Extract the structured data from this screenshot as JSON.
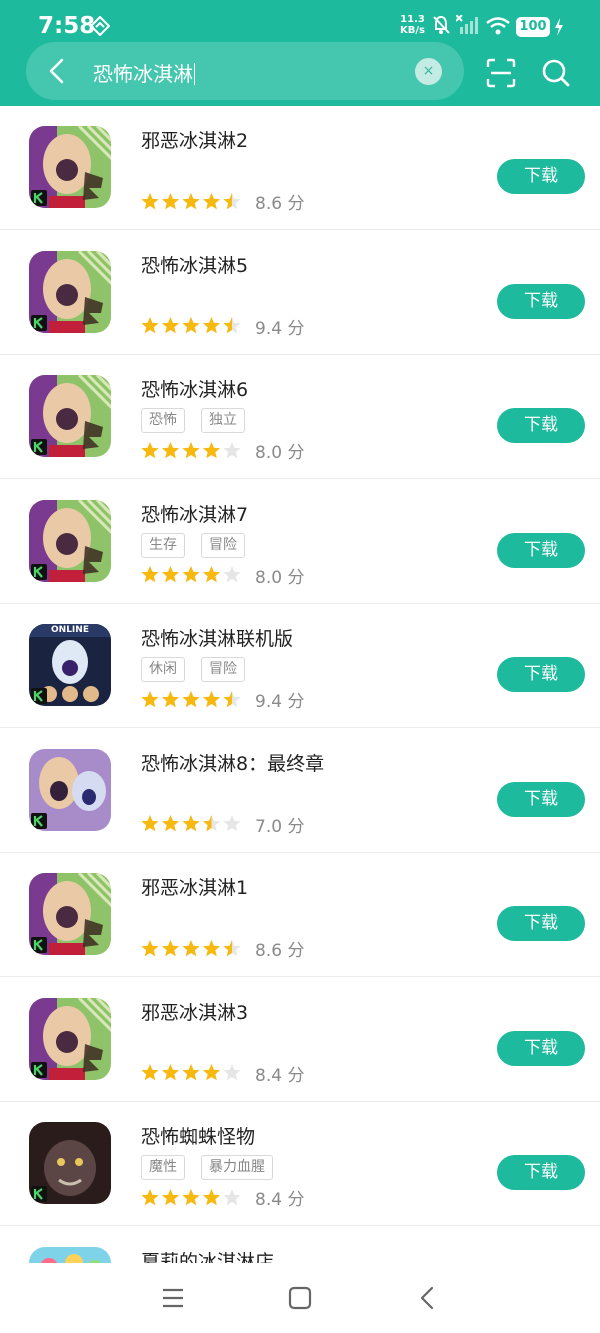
{
  "status_bar": {
    "time": "7:58",
    "network_speed_value": "11.3",
    "network_speed_unit": "KB/s",
    "battery": "100",
    "icons": [
      "location-sync-icon",
      "mute-bell-icon",
      "signal-off-icon",
      "wifi-icon",
      "battery-icon",
      "charging-icon"
    ]
  },
  "search": {
    "query": "恐怖冰淇淋",
    "clear_symbol": "×"
  },
  "toolbar_icons": [
    "back-arrow-icon",
    "clear-icon",
    "scan-icon",
    "search-icon"
  ],
  "colors": {
    "primary": "#1dba9d",
    "search_bar": "#44c7ae",
    "star_filled": "#f7b90f",
    "star_empty": "#e6e6e6"
  },
  "download_label": "下载",
  "score_unit": "分",
  "results": [
    {
      "name": "邪恶冰淇淋2",
      "tags": [],
      "stars": 4.5,
      "score": "8.6"
    },
    {
      "name": "恐怖冰淇淋5",
      "tags": [],
      "stars": 4.5,
      "score": "9.4"
    },
    {
      "name": "恐怖冰淇淋6",
      "tags": [
        "恐怖",
        "独立"
      ],
      "stars": 4,
      "score": "8.0"
    },
    {
      "name": "恐怖冰淇淋7",
      "tags": [
        "生存",
        "冒险"
      ],
      "stars": 4,
      "score": "8.0"
    },
    {
      "name": "恐怖冰淇淋联机版",
      "tags": [
        "休闲",
        "冒险"
      ],
      "stars": 4.5,
      "score": "9.4",
      "icon_text": "ONLINE"
    },
    {
      "name": "恐怖冰淇淋8：最终章",
      "tags": [],
      "stars": 3.5,
      "score": "7.0"
    },
    {
      "name": "邪恶冰淇淋1",
      "tags": [],
      "stars": 4.5,
      "score": "8.6"
    },
    {
      "name": "邪恶冰淇淋3",
      "tags": [],
      "stars": 4,
      "score": "8.4"
    },
    {
      "name": "恐怖蜘蛛怪物",
      "tags": [
        "魔性",
        "暴力血腥"
      ],
      "stars": 4,
      "score": "8.4"
    },
    {
      "name": "夏莉的冰淇淋店",
      "tags": [],
      "stars": null,
      "score": null
    }
  ],
  "nav_icons": [
    "menu-icon",
    "home-icon",
    "back-icon"
  ]
}
